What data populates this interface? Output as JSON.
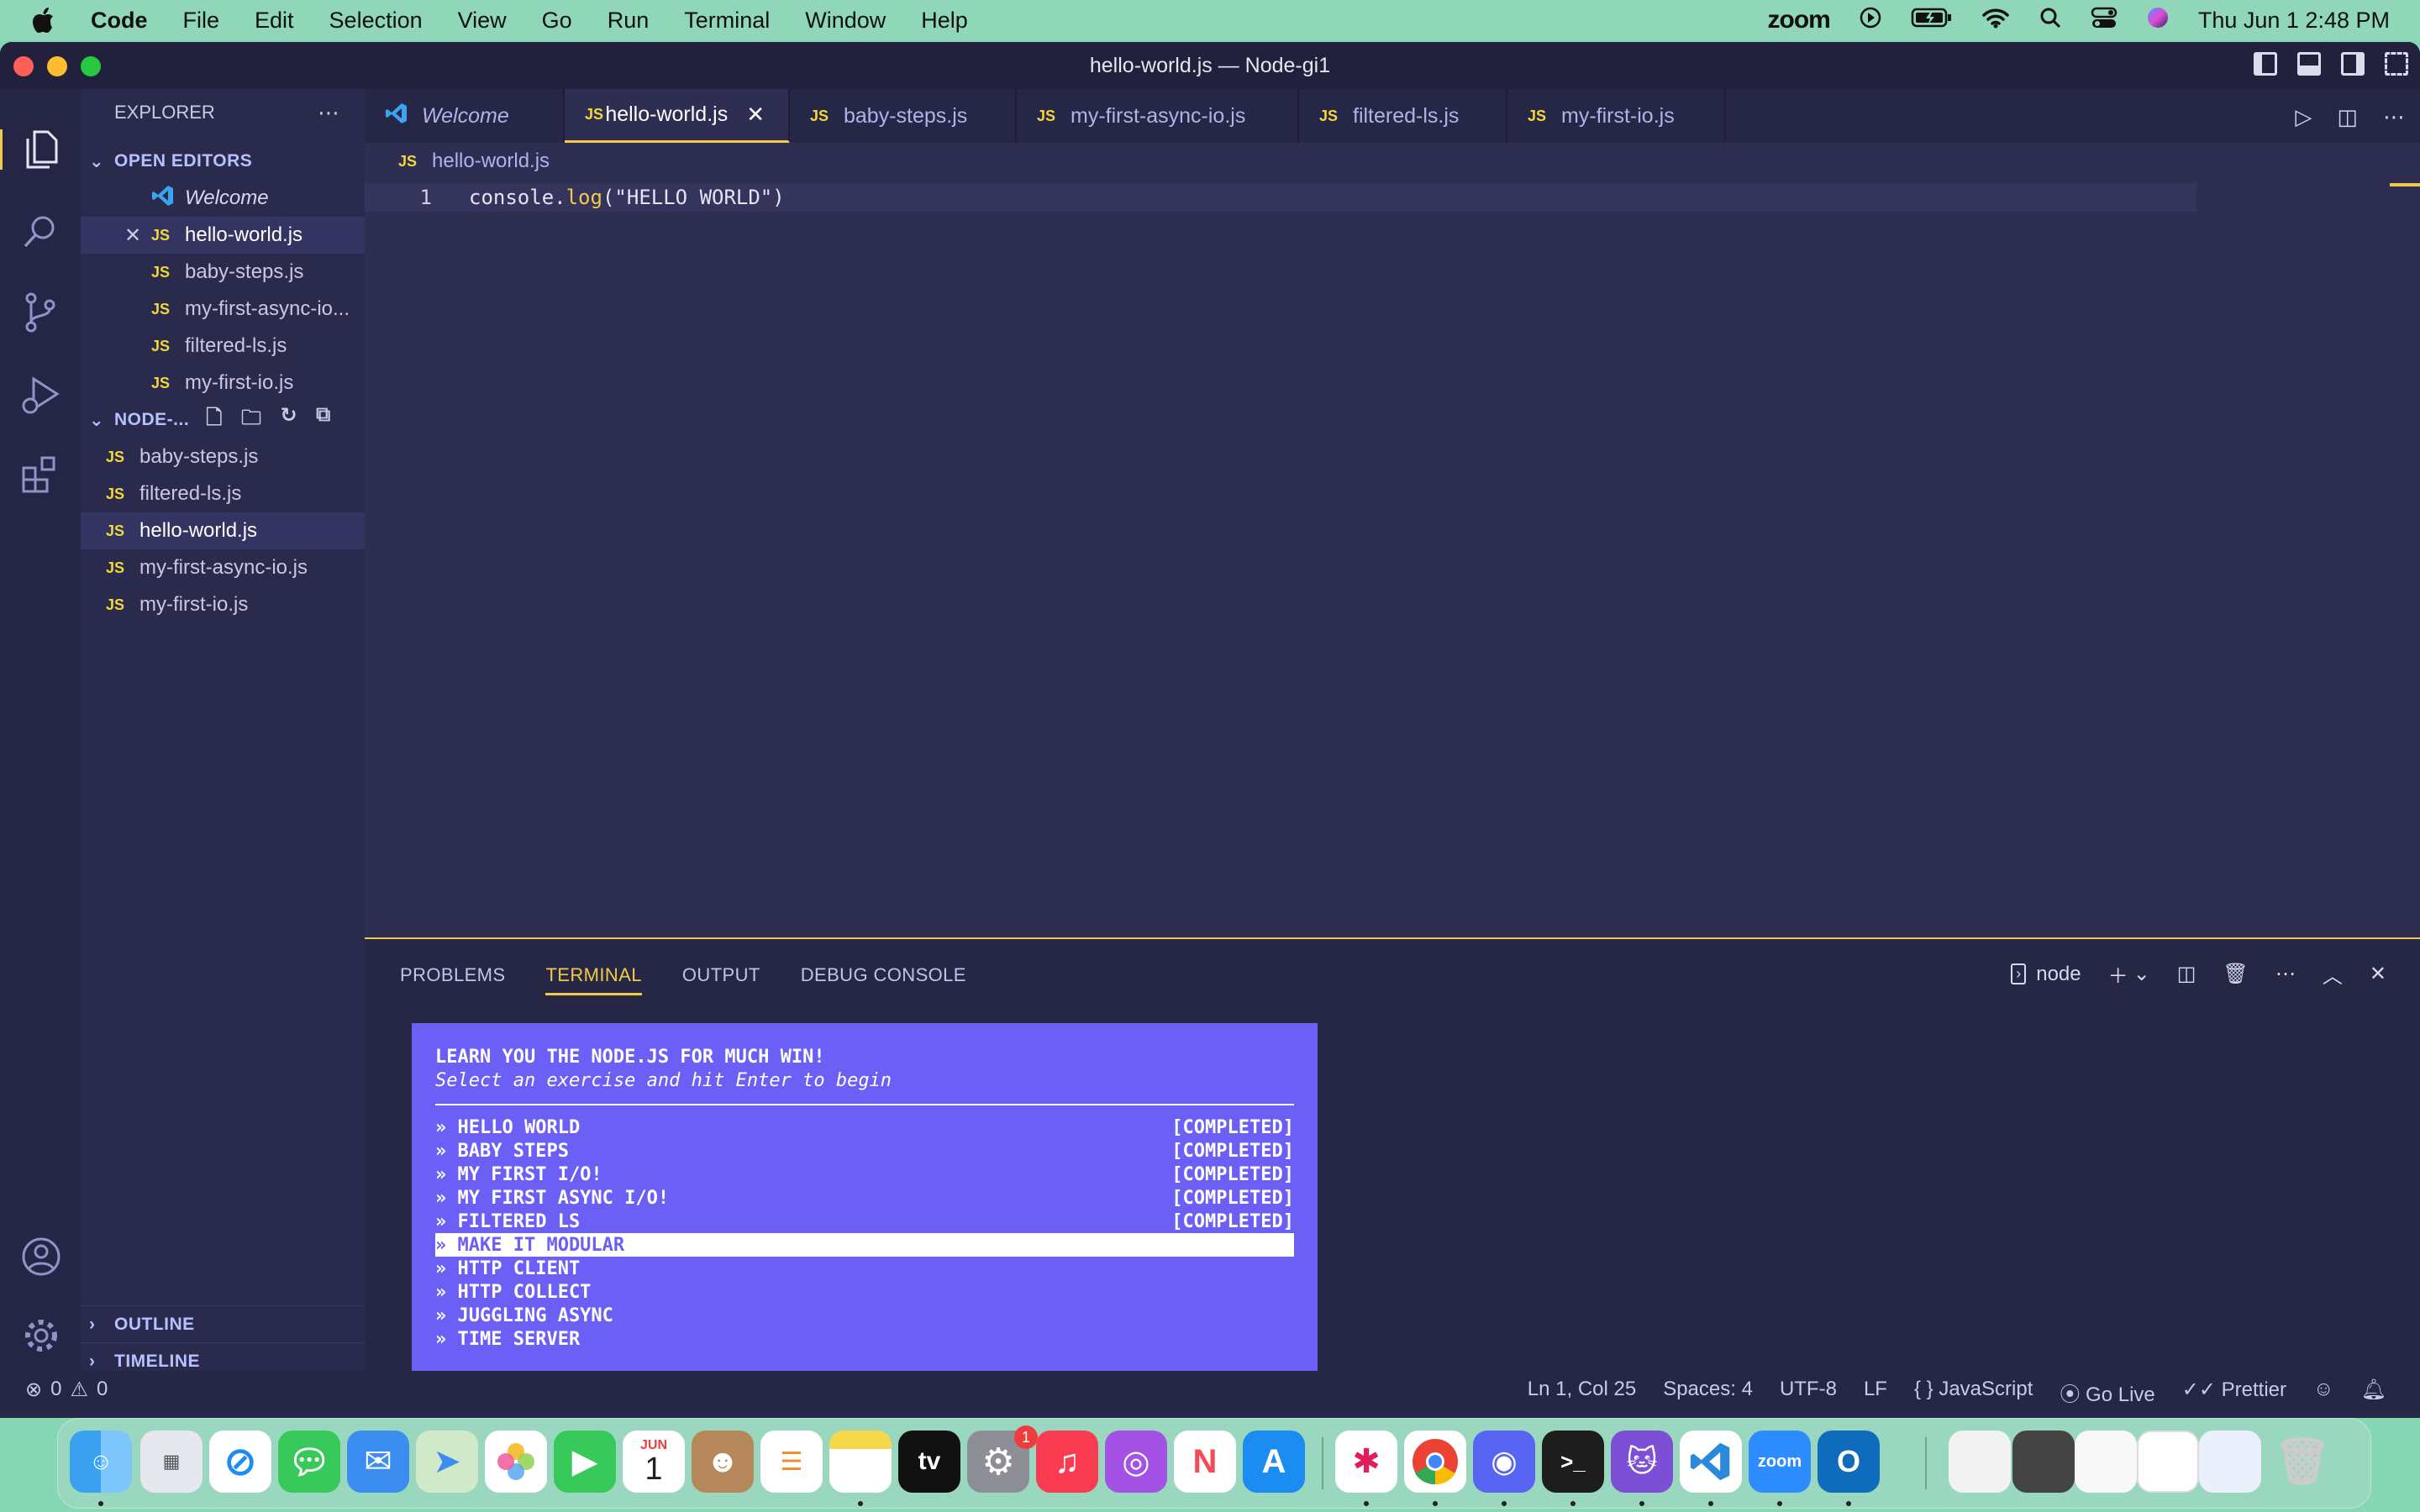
{
  "menubar": {
    "app": "Code",
    "items": [
      "File",
      "Edit",
      "Selection",
      "View",
      "Go",
      "Run",
      "Terminal",
      "Window",
      "Help"
    ],
    "zoom_label": "zoom",
    "clock": "Thu Jun 1  2:48 PM"
  },
  "window": {
    "title": "hello-world.js — Node-gi1"
  },
  "sidebar": {
    "header": "EXPLORER",
    "open_editors_label": "OPEN EDITORS",
    "open_editors": [
      {
        "name": "Welcome",
        "type": "vscode"
      },
      {
        "name": "hello-world.js",
        "type": "js"
      },
      {
        "name": "baby-steps.js",
        "type": "js"
      },
      {
        "name": "my-first-async-io...",
        "type": "js"
      },
      {
        "name": "filtered-ls.js",
        "type": "js"
      },
      {
        "name": "my-first-io.js",
        "type": "js"
      }
    ],
    "folder_label": "NODE-...",
    "files": [
      "baby-steps.js",
      "filtered-ls.js",
      "hello-world.js",
      "my-first-async-io.js",
      "my-first-io.js"
    ],
    "outline_label": "OUTLINE",
    "timeline_label": "TIMELINE",
    "js_badge": "JS"
  },
  "tabs": [
    {
      "label": "Welcome",
      "type": "vscode"
    },
    {
      "label": "hello-world.js",
      "type": "js",
      "active": true
    },
    {
      "label": "baby-steps.js",
      "type": "js"
    },
    {
      "label": "my-first-async-io.js",
      "type": "js"
    },
    {
      "label": "filtered-ls.js",
      "type": "js"
    },
    {
      "label": "my-first-io.js",
      "type": "js"
    }
  ],
  "breadcrumb": "hello-world.js",
  "editor": {
    "line_number": "1",
    "code_obj": "console",
    "code_dot": ".",
    "code_fn": "log",
    "code_args": "(\"HELLO WORLD\")"
  },
  "panel": {
    "tabs": [
      "PROBLEMS",
      "TERMINAL",
      "OUTPUT",
      "DEBUG CONSOLE"
    ],
    "active_tab": "TERMINAL",
    "shell_name": "node"
  },
  "terminal": {
    "title": "LEARN YOU THE NODE.JS FOR MUCH WIN!",
    "subtitle": "Select an exercise and hit Enter to begin",
    "exercises": [
      {
        "label": "» HELLO WORLD",
        "status": "[COMPLETED]"
      },
      {
        "label": "» BABY STEPS",
        "status": "[COMPLETED]"
      },
      {
        "label": "» MY FIRST I/O!",
        "status": "[COMPLETED]"
      },
      {
        "label": "» MY FIRST ASYNC I/O!",
        "status": "[COMPLETED]"
      },
      {
        "label": "» FILTERED LS",
        "status": "[COMPLETED]"
      },
      {
        "label": "» MAKE IT MODULAR",
        "status": "",
        "selected": true
      },
      {
        "label": "» HTTP CLIENT",
        "status": ""
      },
      {
        "label": "» HTTP COLLECT",
        "status": ""
      },
      {
        "label": "» JUGGLING ASYNC",
        "status": ""
      },
      {
        "label": "» TIME SERVER",
        "status": ""
      }
    ]
  },
  "statusbar": {
    "errors": "0",
    "warnings": "0",
    "position": "Ln 1, Col 25",
    "spaces": "Spaces: 4",
    "encoding": "UTF-8",
    "eol": "LF",
    "language": "JavaScript",
    "golive": "Go Live",
    "prettier": "Prettier"
  },
  "dock": {
    "calendar_month": "JUN",
    "calendar_day": "1",
    "settings_badge": "1",
    "tv_label": "tv",
    "zoom_label": "zoom"
  },
  "colors": {
    "accent": "#f3c94a",
    "editor_bg": "#2e2e52",
    "terminal_box": "#6c5ff5",
    "js_icon": "#f0d73a"
  }
}
